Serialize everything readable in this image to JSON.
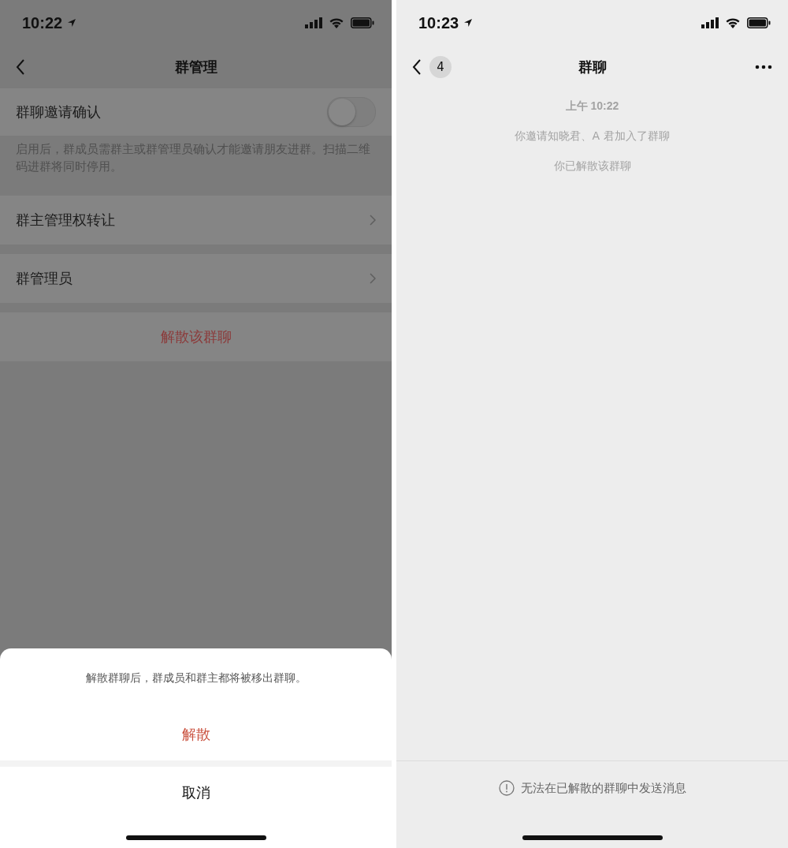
{
  "left_screen": {
    "status_bar": {
      "time": "10:22"
    },
    "nav": {
      "title": "群管理"
    },
    "settings": [
      {
        "kind": "toggle",
        "label": "群聊邀请确认",
        "on": false
      },
      {
        "kind": "note",
        "text": "启用后，群成员需群主或群管理员确认才能邀请朋友进群。扫描二维码进群将同时停用。"
      },
      {
        "kind": "link",
        "label": "群主管理权转让"
      },
      {
        "kind": "link",
        "label": "群管理员"
      },
      {
        "kind": "danger",
        "label": "解散该群聊"
      }
    ],
    "action_sheet": {
      "message": "解散群聊后，群成员和群主都将被移出群聊。",
      "confirm": "解散",
      "cancel": "取消"
    }
  },
  "right_screen": {
    "status_bar": {
      "time": "10:23"
    },
    "nav": {
      "badge": "4",
      "title": "群聊"
    },
    "messages": [
      {
        "kind": "time",
        "text": "上午 10:22"
      },
      {
        "kind": "system",
        "text": "你邀请知晓君、A 君加入了群聊"
      },
      {
        "kind": "system",
        "text": "你已解散该群聊"
      }
    ],
    "footer": {
      "notice": "无法在已解散的群聊中发送消息"
    }
  }
}
